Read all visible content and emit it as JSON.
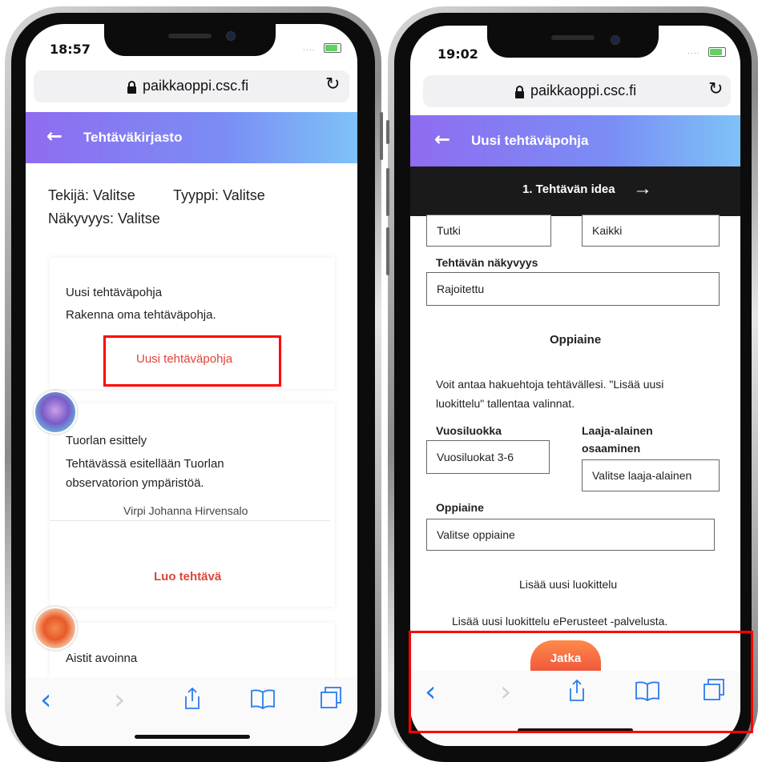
{
  "left_phone": {
    "time": "18:57",
    "url": "paikkaoppi.csc.fi",
    "header_title": "Tehtäväkirjasto",
    "filters": {
      "tekija": "Tekijä: Valitse",
      "tyyppi": "Tyyppi: Valitse",
      "nakyvyys": "Näkyvyys: Valitse"
    },
    "new_template_card": {
      "title": "Uusi tehtäväpohja",
      "description": "Rakenna oma tehtäväpohja.",
      "button": "Uusi tehtäväpohja"
    },
    "task_card": {
      "title": "Tuorlan esittely",
      "description_line1": "Tehtävässä esitellään Tuorlan",
      "description_line2": "observatorion ympäristöä.",
      "author": "Virpi Johanna Hirvensalo",
      "button": "Luo tehtävä"
    },
    "next_card_title": "Aistit avoinna"
  },
  "right_phone": {
    "time": "19:02",
    "url": "paikkaoppi.csc.fi",
    "header_title": "Uusi tehtäväpohja",
    "step_label": "1. Tehtävän idea",
    "field_tutki": "Tutki",
    "field_kaikki": "Kaikki",
    "visibility_label": "Tehtävän näkyvyys",
    "visibility_value": "Rajoitettu",
    "section_heading": "Oppiaine",
    "help_line1": "Voit antaa hakuehtoja tehtävällesi. \"Lisää uusi",
    "help_line2": "luokittelu\" tallentaa valinnat.",
    "grade_label": "Vuosiluokka",
    "grade_value": "Vuosiluokat 3-6",
    "competence_label_line1": "Laaja-alainen",
    "competence_label_line2": "osaaminen",
    "competence_value": "Valitse laaja-alainen",
    "subject_label": "Oppiaine",
    "subject_value": "Valitse oppiaine",
    "add_classification": "Lisää uusi luokittelu",
    "add_from_eperusteet": "Lisää uusi luokittelu ePerusteet -palvelusta.",
    "continue_button": "Jatka"
  },
  "icons": {
    "back": "←",
    "forward_step": "→",
    "reload": "↻",
    "toolbar_back": "‹",
    "toolbar_forward": "›"
  },
  "colors": {
    "accent_red": "#e0433a",
    "highlight_box": "#ff0000",
    "ios_blue": "#2b7cf0",
    "header_gradient_start": "#8f6cf0",
    "header_gradient_end": "#7ec2f7"
  }
}
